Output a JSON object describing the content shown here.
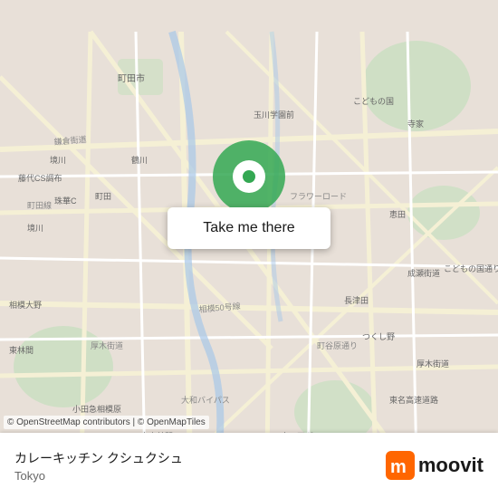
{
  "map": {
    "background_color": "#e8e0d8",
    "attribution": "© OpenStreetMap contributors | © OpenMapTiles"
  },
  "button": {
    "label": "Take me there"
  },
  "place": {
    "name": "カレーキッチン クシュクシュ",
    "city": "Tokyo"
  },
  "branding": {
    "name": "moovit"
  },
  "pin": {
    "color": "#34A853"
  }
}
